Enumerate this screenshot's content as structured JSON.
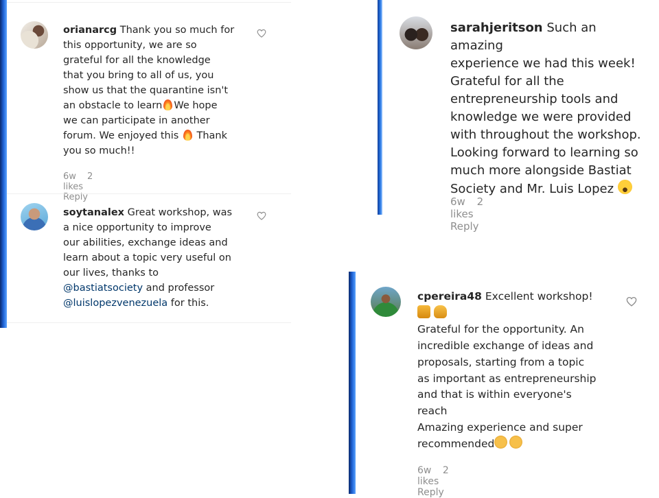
{
  "comments": [
    {
      "username": "orianarcg",
      "lines": [
        "Thank you so much for",
        "this opportunity, we are so",
        "grateful for all the knowledge",
        "that you bring to all of us, you",
        "show us that the quarantine isn't",
        "an obstacle to learn",
        "We hope",
        "we can participate in another",
        "forum. We enjoyed this",
        "Thank",
        "you so much!!"
      ],
      "age": "6w",
      "likes": "2 likes",
      "reply": "Reply"
    },
    {
      "username": "soytanalex",
      "lines": [
        "Great workshop, was",
        "a nice opportunity to improve",
        "our abilities, exchange ideas and",
        "learn about a topic very useful on",
        "our lives, thanks to",
        "and professor",
        "for this."
      ],
      "mentions": [
        "@bastiatsociety",
        "@luislopezvenezuela"
      ]
    },
    {
      "username": "sarahjeritson",
      "lines": [
        "Such an amazing",
        "experience we had this week!",
        "Grateful for all the",
        "entrepreneurship tools and",
        "knowledge we were provided",
        "with throughout the workshop.",
        "Looking forward to learning so",
        "much more alongside Bastiat",
        "Society and Mr. Luis Lopez"
      ],
      "age": "6w",
      "likes": "2 likes",
      "reply": "Reply"
    },
    {
      "username": "cpereira48",
      "lines": [
        "Excellent workshop!",
        "Grateful for the opportunity. An",
        "incredible exchange of ideas and",
        "proposals, starting from a topic",
        "as important as entrepreneurship",
        "and that is within everyone's",
        "reach",
        "Amazing experience and super",
        "recommended"
      ],
      "age": "6w",
      "likes": "2 likes",
      "reply": "Reply"
    }
  ],
  "icons": {
    "like": "heart-outline-icon",
    "fire": "fire-emoji-icon",
    "smile": "smiling-face-emoji-icon",
    "raised_hands": "raising-hands-emoji-icon",
    "flexed_bicep": "flexed-bicep-emoji-icon",
    "clap": "clapping-hands-emoji-icon"
  },
  "colors": {
    "text": "#262626",
    "meta": "#8e8e8e",
    "mention": "#00376b",
    "edge_blue": "#1f63d6"
  }
}
